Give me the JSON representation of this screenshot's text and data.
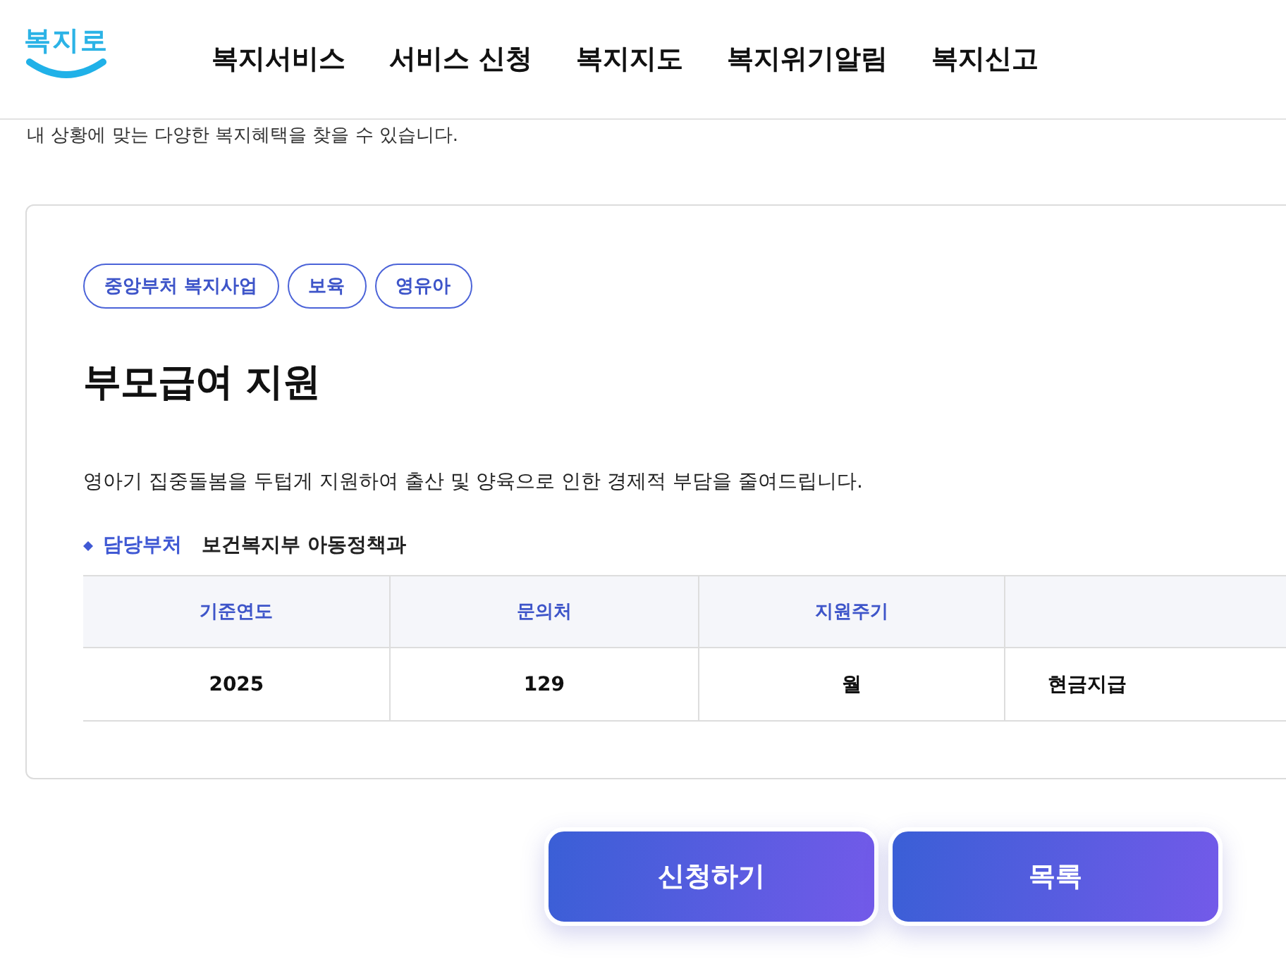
{
  "header": {
    "logo": "복지로",
    "nav": [
      {
        "label": "복지서비스"
      },
      {
        "label": "서비스 신청"
      },
      {
        "label": "복지지도"
      },
      {
        "label": "복지위기알림"
      },
      {
        "label": "복지신고"
      }
    ]
  },
  "intro": "내 상황에 맞는 다양한 복지혜택을 찾을 수 있습니다.",
  "service": {
    "tags": [
      "중앙부처 복지사업",
      "보육",
      "영유아"
    ],
    "title": "부모급여 지원",
    "description": "영아기 집중돌봄을 두텁게 지원하여 출산 및 양육으로 인한 경제적 부담을 줄여드립니다.",
    "department": {
      "label": "담당부처",
      "value": "보건복지부 아동정책과"
    },
    "table": {
      "columns": [
        "기준연도",
        "문의처",
        "지원주기",
        ""
      ],
      "rows": [
        [
          "2025",
          "129",
          "월",
          "현금지급"
        ]
      ]
    }
  },
  "buttons": [
    "신청하기",
    "목록"
  ]
}
